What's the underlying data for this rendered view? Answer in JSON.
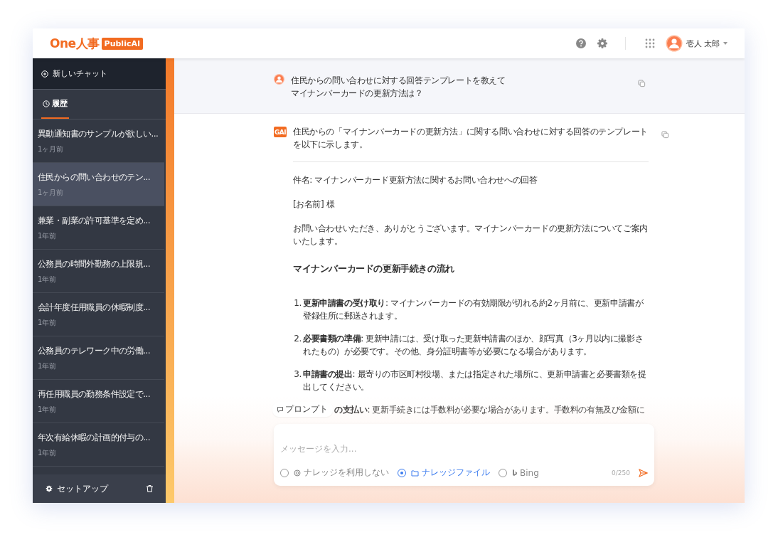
{
  "header": {
    "logo": "One人事",
    "logo_badge": "PublicAI",
    "user_name": "壱人 太郎"
  },
  "sidebar": {
    "new_chat": "新しいチャット",
    "tabs": [
      {
        "label": "履歴",
        "selected": true
      }
    ],
    "items": [
      {
        "title": "異動通知書のサンプルが欲しい...",
        "time": "1ヶ月前",
        "selected": false
      },
      {
        "title": "住民からの問い合わせのテン...",
        "time": "1ヶ月前",
        "selected": true
      },
      {
        "title": "兼業・副業の許可基準を定め...",
        "time": "1年前",
        "selected": false
      },
      {
        "title": "公務員の時間外勤務の上限規...",
        "time": "1年前",
        "selected": false
      },
      {
        "title": "会計年度任用職員の休暇制度...",
        "time": "1年前",
        "selected": false
      },
      {
        "title": "公務員のテレワーク中の労働...",
        "time": "1年前",
        "selected": false
      },
      {
        "title": "再任用職員の勤務条件設定で...",
        "time": "1年前",
        "selected": false
      },
      {
        "title": "年次有給休暇の計画的付与の...",
        "time": "1年前",
        "selected": false
      }
    ],
    "footer": {
      "setup": "セットアップ"
    }
  },
  "conversation": {
    "user_message": [
      "住民からの問い合わせに対する回答テンプレートを教えて",
      "マイナンバーカードの更新方法は？"
    ],
    "ai_badge": "GAI",
    "ai_intro": "住民からの「マイナンバーカードの更新方法」に関する問い合わせに対する回答のテンプレートを以下に示します。",
    "paragraphs": [
      "件名: マイナンバーカード更新方法に関するお問い合わせへの回答",
      "[お名前] 様",
      "お問い合わせいただき、ありがとうございます。マイナンバーカードの更新方法についてご案内いたします。"
    ],
    "heading": "マイナンバーカードの更新手続きの流れ",
    "steps": [
      {
        "number": "1.",
        "text": "**更新申請書の受け取り**: マイナンバーカードの有効期限が切れる約2ヶ月前に、更新申請書が登録住所に郵送されます。"
      },
      {
        "number": "2.",
        "text": "**必要書類の準備**: 更新申請には、受け取った更新申請書のほか、顔写真（3ヶ月以内に撮影されたもの）が必要です。その他、身分証明書等が必要になる場合があります。"
      },
      {
        "number": "3.",
        "text": "**申請書の提出**: 最寄りの市区町村役場、または指定された場所に、更新申請書と必要書類を提出してください。"
      },
      {
        "text": "**の支払い**: 更新手続きには手数料が必要な場合があります。手数料の有無及び金額に"
      }
    ]
  },
  "composer": {
    "prompt_chip": "プロンプト",
    "placeholder": "メッセージを入力...",
    "options": [
      {
        "kind": "none",
        "label": "ナレッジを利用しない",
        "selected": false
      },
      {
        "kind": "folder",
        "label": "ナレッジファイル",
        "selected": true
      },
      {
        "kind": "bing",
        "label": "Bing",
        "selected": false
      }
    ],
    "counter": "0/250"
  }
}
